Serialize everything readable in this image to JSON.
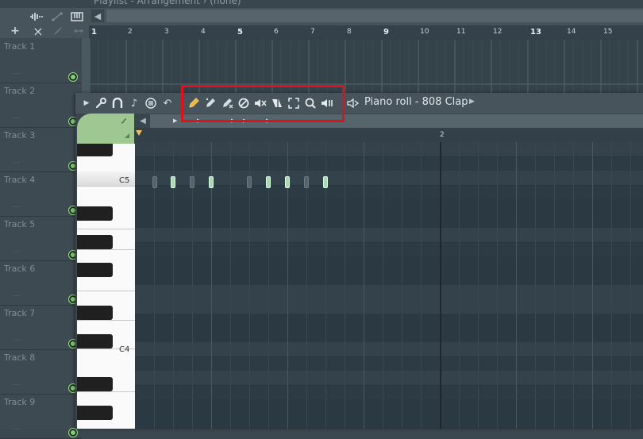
{
  "playlist": {
    "title": "Playlist - Arrangement › (none)",
    "add_label": "+",
    "close_label": "×",
    "bar_numbers": [
      "1",
      "2",
      "3",
      "4",
      "5",
      "6",
      "7",
      "8",
      "9",
      "10",
      "11",
      "12",
      "13",
      "14",
      "15"
    ],
    "tracks": [
      "Track 1",
      "Track 2",
      "Track 3",
      "Track 4",
      "Track 5",
      "Track 6",
      "Track 7",
      "Track 8",
      "Track 9"
    ],
    "track_dots": "..."
  },
  "piano_roll": {
    "title": "Piano roll - 808 Clap",
    "ruler_label": "2",
    "key_labels": {
      "c5": "C5",
      "c4": "C4"
    },
    "toolbar_icons": [
      "menu-arrow-icon",
      "wrench-icon",
      "magnet-icon",
      "note-icon",
      "stamp-icon",
      "undo-icon",
      "pencil-icon",
      "brush-icon",
      "delete-icon",
      "delete-icon-2",
      "mute-icon",
      "slice-icon",
      "select-icon",
      "zoom-icon",
      "playback-icon",
      "speaker-icon"
    ]
  },
  "highlight_color": "#e3101a",
  "accent_color": "#a7dcb3"
}
